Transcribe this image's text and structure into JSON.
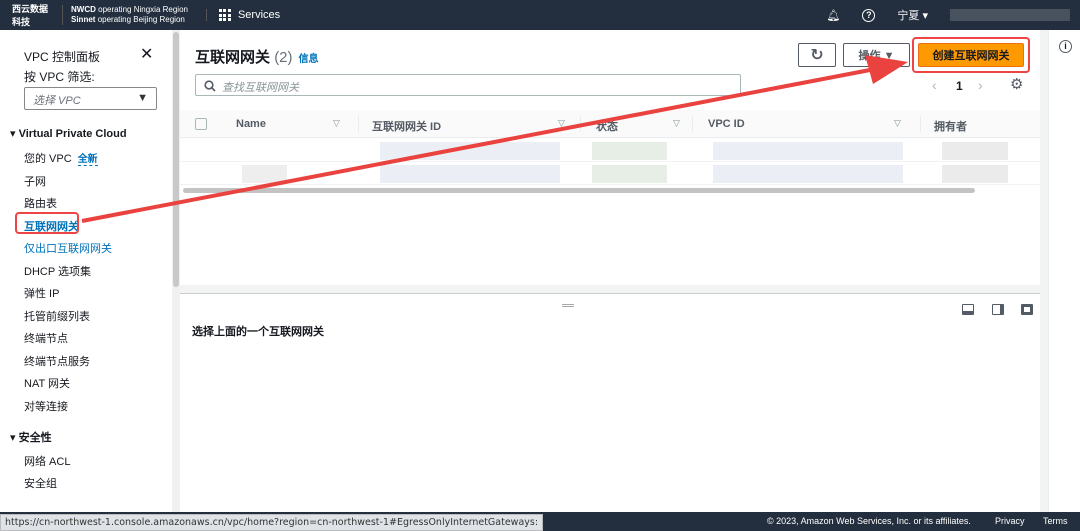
{
  "topbar": {
    "logo": "西云数据科技",
    "region_line1_bold": "NWCD",
    "region_line1": "operating Ningxia Region",
    "region_line2_bold": "Sinnet",
    "region_line2": "operating Beijing Region",
    "services": "Services",
    "region_select": "宁夏 ▾"
  },
  "sidebar": {
    "title": "VPC 控制面板",
    "filter_label": "按 VPC 筛选:",
    "filter_placeholder": "选择 VPC",
    "section_vpc": "Virtual Private Cloud",
    "items": [
      {
        "label": "您的 VPC",
        "badge": "全新"
      },
      {
        "label": "子网"
      },
      {
        "label": "路由表"
      },
      {
        "label": "互联网网关"
      },
      {
        "label": "仅出口互联网网关"
      },
      {
        "label": "DHCP 选项集"
      },
      {
        "label": "弹性 IP"
      },
      {
        "label": "托管前缀列表"
      },
      {
        "label": "终端节点"
      },
      {
        "label": "终端节点服务"
      },
      {
        "label": "NAT 网关"
      },
      {
        "label": "对等连接"
      }
    ],
    "section_security": "安全性",
    "security_items": [
      {
        "label": "网络 ACL"
      },
      {
        "label": "安全组"
      }
    ]
  },
  "main": {
    "title": "互联网网关",
    "count": "(2)",
    "info": "信息",
    "actions": "操作 ▼",
    "create": "创建互联网网关",
    "search_placeholder": "查找互联网网关",
    "page": "1",
    "columns": [
      "Name",
      "互联网网关 ID",
      "状态",
      "VPC ID",
      "拥有者"
    ]
  },
  "split": {
    "text": "选择上面的一个互联网网关"
  },
  "footer": {
    "copyright": "© 2023, Amazon Web Services, Inc. or its affiliates.",
    "privacy": "Privacy",
    "terms": "Terms"
  },
  "status_url": "https://cn-northwest-1.console.amazonaws.cn/vpc/home?region=cn-northwest-1#EgressOnlyInternetGateways:",
  "colors": {
    "header": "#232f3e",
    "primary": "#ff9900",
    "link": "#0073bb",
    "annotation": "#e44444"
  }
}
